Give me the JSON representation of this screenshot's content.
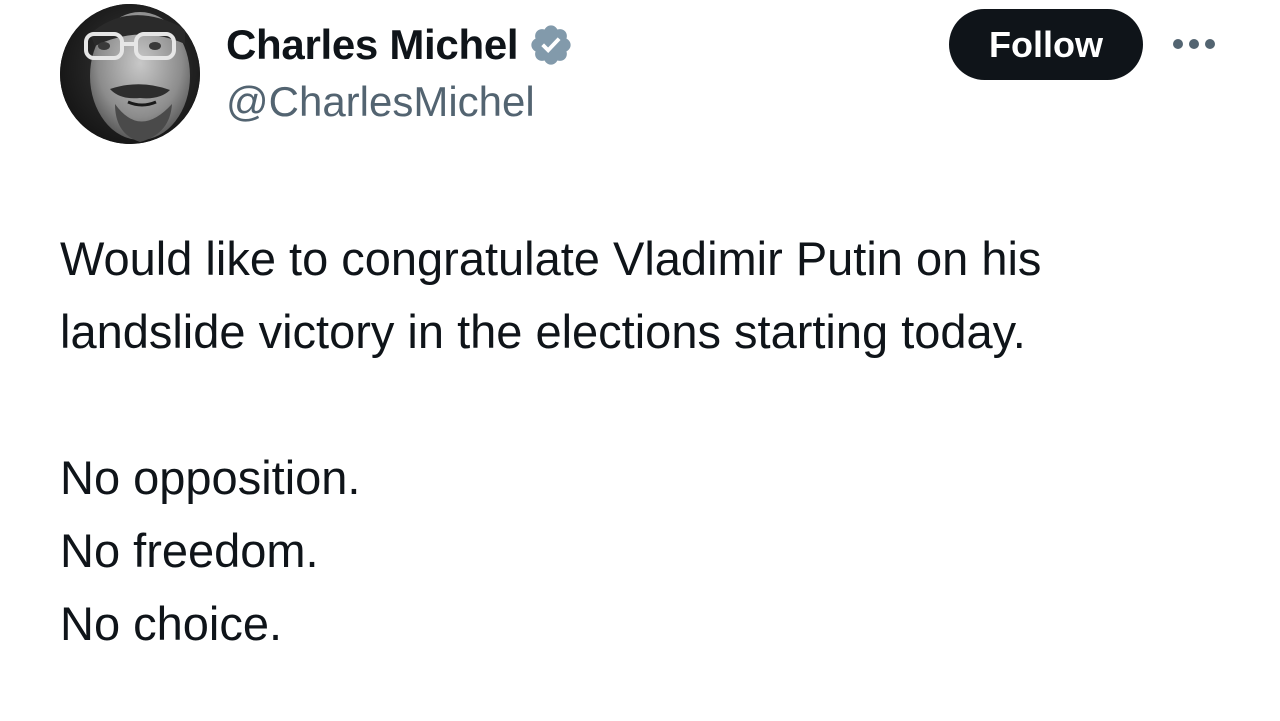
{
  "author": {
    "display_name": "Charles Michel",
    "handle": "@CharlesMichel",
    "verified": true,
    "verified_icon": "verified-badge-icon",
    "avatar_icon": "avatar-photo"
  },
  "actions": {
    "follow_label": "Follow",
    "more_icon": "more-options-icon"
  },
  "tweet": {
    "paragraph_1": [
      "Would like to congratulate Vladimir Putin on his",
      "landslide victory in the elections starting today."
    ],
    "paragraph_2": [
      "No opposition.",
      "No freedom.",
      "No choice."
    ]
  },
  "colors": {
    "text_primary": "#0f1419",
    "text_secondary": "#536471",
    "verified_badge": "#829aab",
    "button_background": "#0f1419",
    "button_text": "#ffffff"
  }
}
